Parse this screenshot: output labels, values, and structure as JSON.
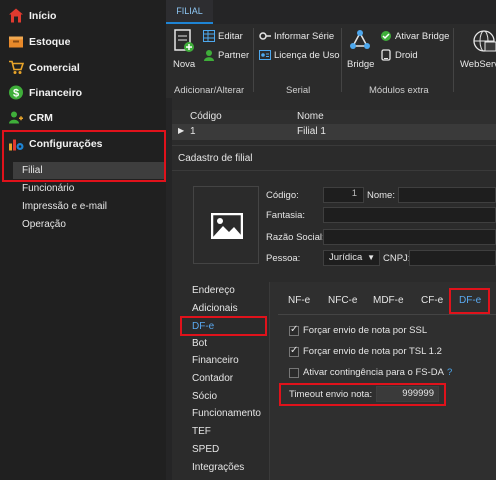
{
  "sidebar": {
    "items": [
      {
        "label": "Início",
        "icon": "home-icon"
      },
      {
        "label": "Estoque",
        "icon": "box-icon"
      },
      {
        "label": "Comercial",
        "icon": "cart-icon"
      },
      {
        "label": "Financeiro",
        "icon": "dollar-icon"
      },
      {
        "label": "CRM",
        "icon": "users-icon"
      },
      {
        "label": "Configurações",
        "icon": "chart-gear-icon"
      }
    ],
    "sub_items": [
      "Filial",
      "Funcionário",
      "Impressão e e-mail",
      "Operação"
    ]
  },
  "top_tab": "FILIAL",
  "ribbon": {
    "nova": "Nova",
    "editar": "Editar",
    "partner": "Partner",
    "informar_serie": "Informar Série",
    "licenca_uso": "Licença de Uso",
    "bridge": "Bridge",
    "ativar_bridge": "Ativar Bridge",
    "droid": "Droid",
    "webservice": "WebServ",
    "groups": [
      "Adicionar/Alterar",
      "Serial",
      "Módulos extra"
    ]
  },
  "grid": {
    "headers": [
      "Código",
      "Nome"
    ],
    "row": {
      "codigo": "1",
      "nome": "Filial 1"
    }
  },
  "cadastro": {
    "title": "Cadastro de filial",
    "codigo_label": "Código:",
    "codigo_value": "1",
    "nome_label": "Nome:",
    "fantasia_label": "Fantasia:",
    "razao_label": "Razão Social:",
    "pessoa_label": "Pessoa:",
    "pessoa_value": "Jurídica",
    "cnpj_label": "CNPJ:"
  },
  "left_tabs": [
    "Endereço",
    "Adicionais",
    "DF-e",
    "Bot",
    "Financeiro",
    "Contador",
    "Sócio",
    "Funcionamento",
    "TEF",
    "SPED",
    "Integrações"
  ],
  "dfe_tabs": [
    "NF-e",
    "NFC-e",
    "MDF-e",
    "CF-e",
    "DF-e"
  ],
  "options": [
    {
      "label": "Forçar envio de nota por SSL",
      "checked": true
    },
    {
      "label": "Forçar envio de nota por TSL 1.2",
      "checked": true
    },
    {
      "label": "Ativar contingência para o FS-DA",
      "checked": false
    }
  ],
  "help_mark": "?",
  "timeout": {
    "label": "Timeout envio nota:",
    "value": "999999"
  },
  "colors": {
    "highlight": "#e0121b",
    "accent": "#1e84d4"
  }
}
